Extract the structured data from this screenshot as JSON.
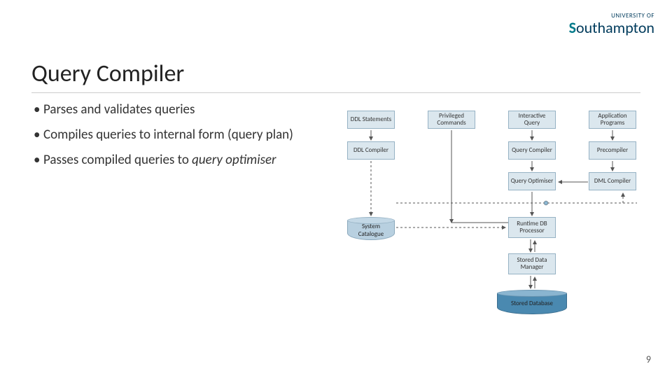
{
  "logo": {
    "tagline": "UNIVERSITY OF",
    "name_main": "Southampton",
    "name_accent_first": "S"
  },
  "title": "Query Compiler",
  "bullets": [
    "Parses and validates queries",
    "Compiles queries to internal form (query plan)",
    "Passes compiled queries to <em>query optimiser</em>"
  ],
  "diagram": {
    "ddl_statements": "DDL\nStatements",
    "priv_commands": "Privileged\nCommands",
    "inter_query": "Interactive\nQuery",
    "app_programs": "Application\nPrograms",
    "ddl_compiler": "DDL\nCompiler",
    "query_compiler": "Query\nCompiler",
    "precompiler": "Precompiler",
    "query_optimiser": "Query\nOptimiser",
    "dml_compiler": "DML\nCompiler",
    "runtime_db": "Runtime DB\nProcessor",
    "stored_data_mgr": "Stored Data\nManager",
    "system_catalogue": "System\nCatalogue",
    "stored_database": "Stored Database"
  },
  "page_number": "9"
}
